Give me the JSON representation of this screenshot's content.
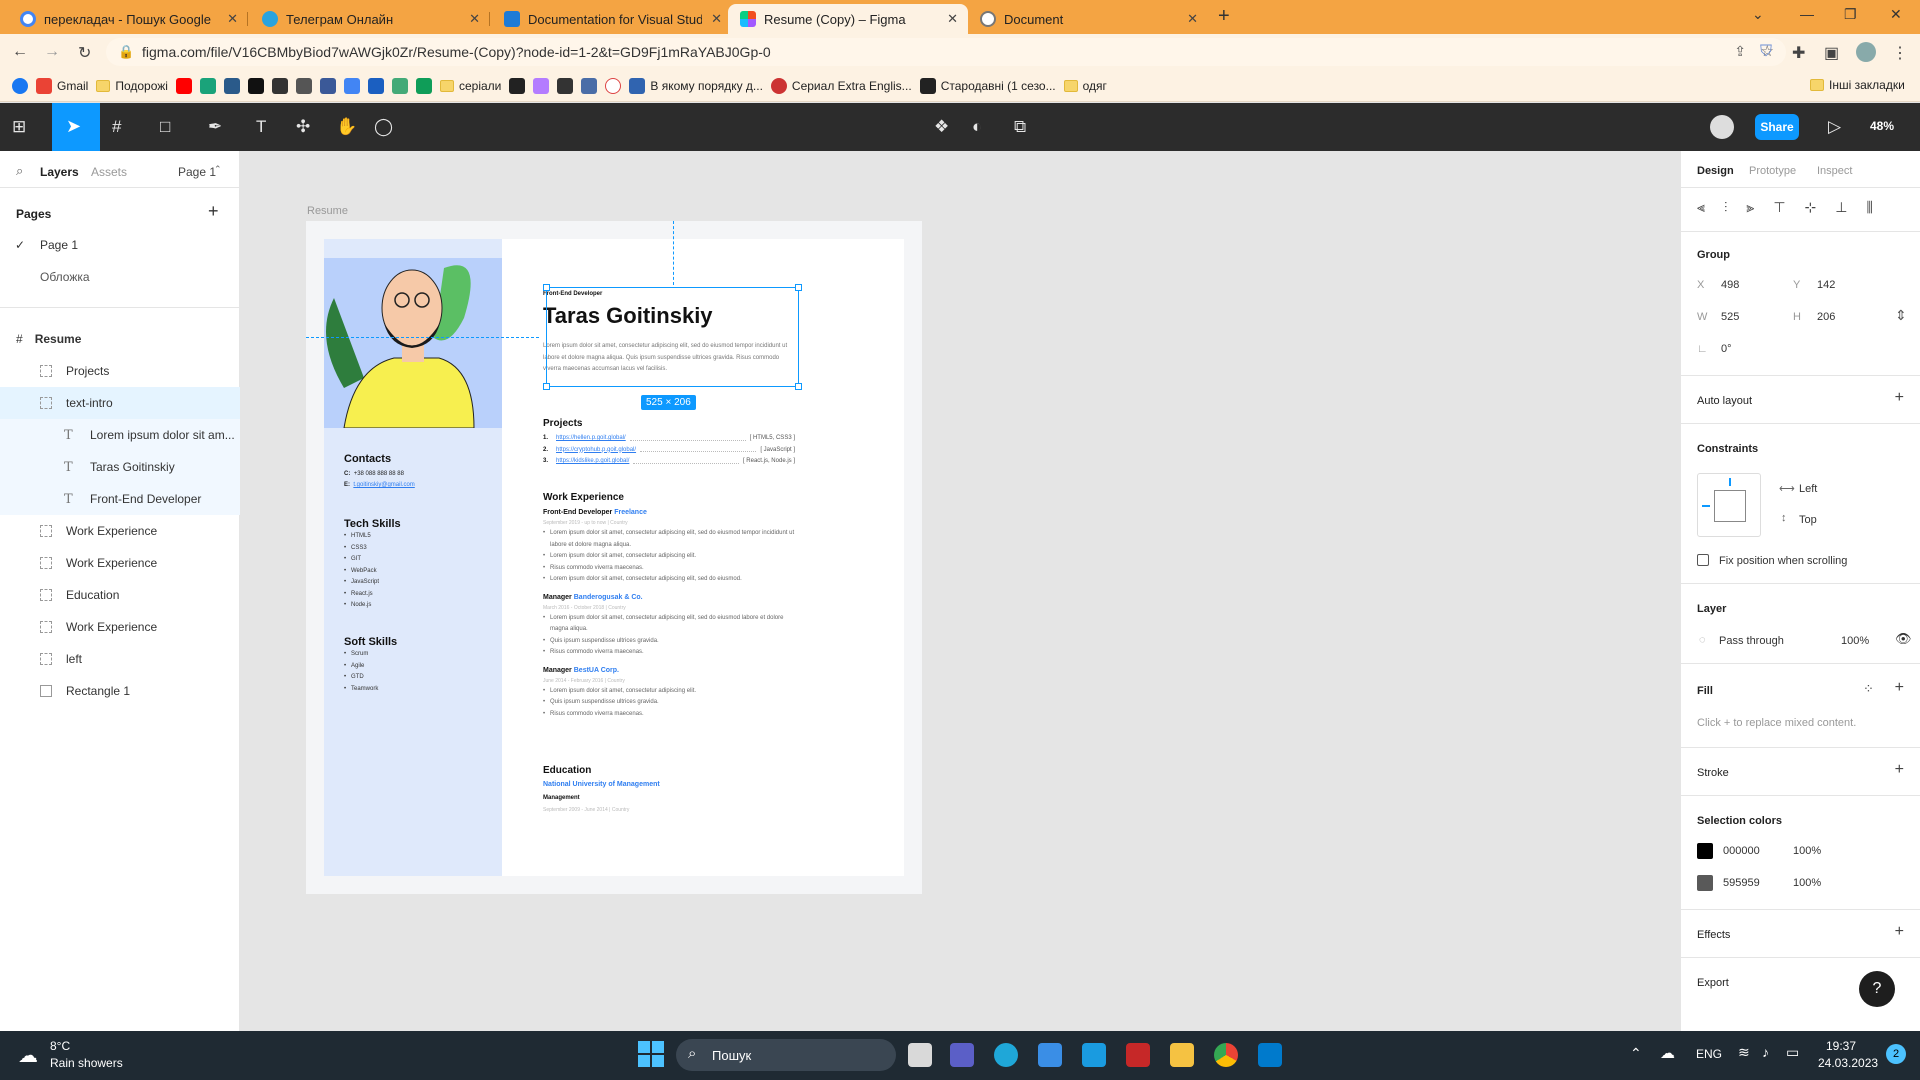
{
  "browser": {
    "tabs": [
      {
        "title": "перекладач - Пошук Google",
        "color": "#4285f4"
      },
      {
        "title": "Телеграм Онлайн",
        "color": "#2aa3df"
      },
      {
        "title": "Documentation for Visual Studio",
        "color": "#1e7bd6"
      },
      {
        "title": "Resume (Copy) – Figma",
        "color": "#f24e1e"
      },
      {
        "title": "Document",
        "color": "#777777"
      }
    ],
    "url": "figma.com/file/V16CBMbyBiod7wAWGjk0Zr/Resume-(Copy)?node-id=1-2&t=GD9Fj1mRaYABJ0Gp-0",
    "bookmarks": {
      "gmail": "Gmail",
      "podorozhi": "Подорожі",
      "seriali": "серіали",
      "order": "В якому порядку д...",
      "extra": "Сериал Extra Englis...",
      "ancient": "Стародавні (1 сезо...",
      "clothes": "одяг",
      "other": "Інші закладки"
    }
  },
  "figma": {
    "zoom": "48%",
    "share_label": "Share",
    "left_tabs": {
      "layers": "Layers",
      "assets": "Assets",
      "page": "Page 1"
    },
    "pages_label": "Pages",
    "pages": [
      "Page 1",
      "Обложка"
    ],
    "frame_name": "Resume",
    "layers": [
      {
        "name": "Projects",
        "kind": "group",
        "state": ""
      },
      {
        "name": "text-intro",
        "kind": "group",
        "state": "sel"
      },
      {
        "name": "Lorem ipsum dolor sit am...",
        "kind": "text",
        "state": "sub"
      },
      {
        "name": "Taras Goitinskiy",
        "kind": "text",
        "state": "sub"
      },
      {
        "name": "Front-End Developer",
        "kind": "text",
        "state": "sub"
      },
      {
        "name": "Work Experience",
        "kind": "group",
        "state": ""
      },
      {
        "name": "Work Experience",
        "kind": "group",
        "state": ""
      },
      {
        "name": "Education",
        "kind": "group",
        "state": ""
      },
      {
        "name": "Work Experience",
        "kind": "group",
        "state": ""
      },
      {
        "name": "left",
        "kind": "group",
        "state": ""
      },
      {
        "name": "Rectangle 1",
        "kind": "rect",
        "state": ""
      }
    ],
    "right": {
      "tabs": {
        "design": "Design",
        "prototype": "Prototype",
        "inspect": "Inspect"
      },
      "group_label": "Group",
      "x_label": "X",
      "x": "498",
      "y_label": "Y",
      "y": "142",
      "w_label": "W",
      "w": "525",
      "h_label": "H",
      "h": "206",
      "rotation": "0°",
      "auto_layout": "Auto layout",
      "constraints": "Constraints",
      "constraint_h": "Left",
      "constraint_v": "Top",
      "fix_position": "Fix position when scrolling",
      "layer": "Layer",
      "blend": "Pass through",
      "opacity": "100%",
      "fill": "Fill",
      "fill_hint": "Click + to replace mixed content.",
      "stroke": "Stroke",
      "selection_colors": "Selection colors",
      "colors": [
        {
          "hex": "000000",
          "opacity": "100%",
          "swatch": "#000000"
        },
        {
          "hex": "595959",
          "opacity": "100%",
          "swatch": "#595959"
        }
      ],
      "effects": "Effects",
      "export": "Export"
    },
    "size_badge": "525 × 206"
  },
  "resume": {
    "role": "Front-End Developer",
    "name": "Taras Goitinskiy",
    "intro": "Lorem ipsum dolor sit amet, consectetur adipiscing elit, sed do eiusmod tempor incididunt ut labore et dolore magna aliqua. Quis ipsum suspendisse ultrices gravida. Risus commodo viverra maecenas accumsan lacus vel facilisis.",
    "contacts_title": "Contacts",
    "contact_phone_label": "C:",
    "contact_phone": "+38 088 888 88 88",
    "contact_email_label": "E:",
    "contact_email": "t.goitinskiy@gmail.com",
    "tech_title": "Tech Skills",
    "tech": [
      "HTML5",
      "CSS3",
      "GIT",
      "WebPack",
      "JavaScript",
      "React.js",
      "Node.js"
    ],
    "soft_title": "Soft Skills",
    "soft": [
      "Scrum",
      "Agile",
      "GTD",
      "Teamwork"
    ],
    "projects_title": "Projects",
    "projects": [
      {
        "n": "1.",
        "url": "https://hellen.p.goit.global/",
        "tech": "[ HTML5, CSS3 ]"
      },
      {
        "n": "2.",
        "url": "https://cryptohub.p.goit.global/",
        "tech": "[ JavaScript ]"
      },
      {
        "n": "3.",
        "url": "https://kidslike.p.goit.global/",
        "tech": "[ React.js, Node.js ]"
      }
    ],
    "work_title": "Work Experience",
    "jobs": [
      {
        "role": "Front-End Developer",
        "company": "Freelance",
        "dates": "September 2019 - up to now  |  Country",
        "bullets": [
          "Lorem ipsum dolor sit amet, consectetur adipiscing elit, sed do eiusmod tempor incididunt ut labore et dolore magna aliqua.",
          "Lorem ipsum dolor sit amet, consectetur adipiscing elit.",
          "Risus commodo viverra maecenas.",
          "Lorem ipsum dolor sit amet, consectetur adipiscing elit, sed do eiusmod."
        ]
      },
      {
        "role": "Manager",
        "company": "Banderogusak & Co.",
        "dates": "March 2016 - October 2018  |  Country",
        "bullets": [
          "Lorem ipsum dolor sit amet, consectetur adipiscing elit, sed do eiusmod labore et dolore magna aliqua.",
          "Quis ipsum suspendisse ultrices gravida.",
          "Risus commodo viverra maecenas."
        ]
      },
      {
        "role": "Manager",
        "company": "BestUA Corp.",
        "dates": "June 2014 - February 2016  |  Country",
        "bullets": [
          "Lorem ipsum dolor sit amet, consectetur adipiscing elit.",
          "Quis ipsum suspendisse ultrices gravida.",
          "Risus commodo viverra maecenas."
        ]
      }
    ],
    "edu_title": "Education",
    "edu_school": "National University of Management",
    "edu_degree": "Management",
    "edu_dates": "September 2009 - June 2014  |  Country"
  },
  "taskbar": {
    "temp": "8°C",
    "weather": "Rain showers",
    "search": "Пошук",
    "lang": "ENG",
    "time": "19:37",
    "date": "24.03.2023",
    "badge": "2"
  }
}
